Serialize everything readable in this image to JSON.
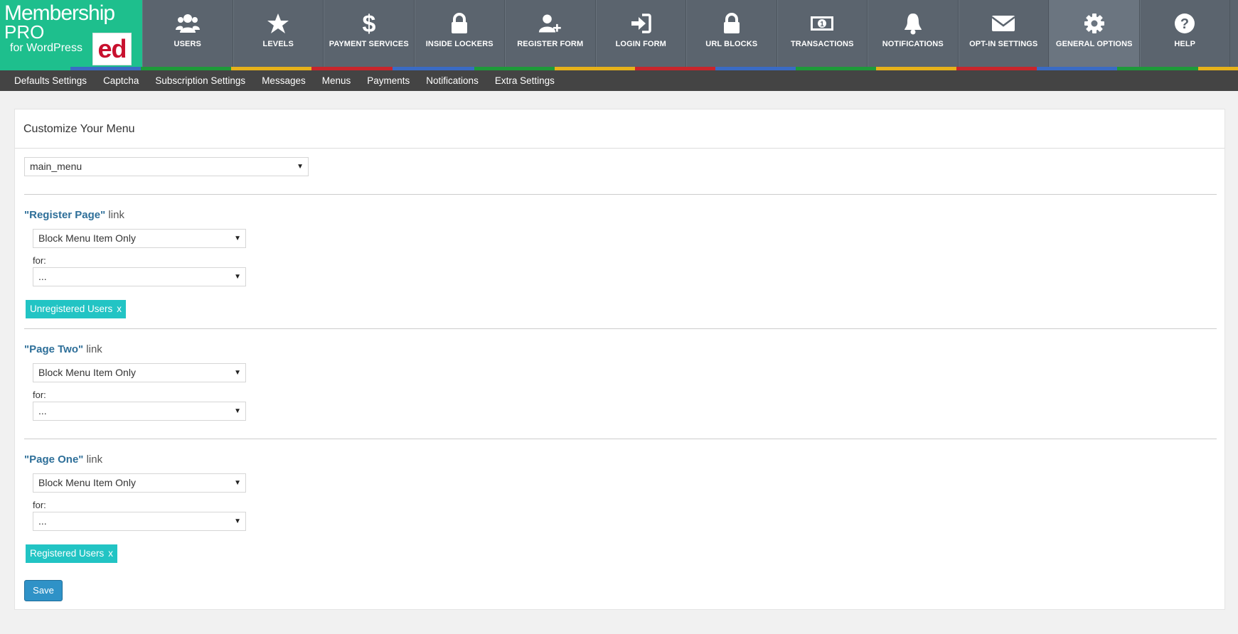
{
  "brand": {
    "line1": "Membership",
    "line2": "PRO",
    "line3": "for WordPress",
    "badge": "ed"
  },
  "tabs": [
    {
      "label": "USERS",
      "icon": "users-icon"
    },
    {
      "label": "LEVELS",
      "icon": "star-icon"
    },
    {
      "label": "PAYMENT SERVICES",
      "icon": "dollar-icon"
    },
    {
      "label": "INSIDE LOCKERS",
      "icon": "lock-icon"
    },
    {
      "label": "REGISTER FORM",
      "icon": "user-plus-icon"
    },
    {
      "label": "LOGIN FORM",
      "icon": "sign-in-icon"
    },
    {
      "label": "URL BLOCKS",
      "icon": "lock-icon"
    },
    {
      "label": "TRANSACTIONS",
      "icon": "money-icon"
    },
    {
      "label": "NOTIFICATIONS",
      "icon": "bell-icon"
    },
    {
      "label": "OPT-IN SETTINGS",
      "icon": "envelope-icon"
    },
    {
      "label": "GENERAL OPTIONS",
      "icon": "gear-icon",
      "active": true
    },
    {
      "label": "HELP",
      "icon": "question-icon"
    }
  ],
  "subnav": [
    "Defaults Settings",
    "Captcha",
    "Subscription Settings",
    "Messages",
    "Menus",
    "Payments",
    "Notifications",
    "Extra Settings"
  ],
  "panel": {
    "title": "Customize Your Menu",
    "menu_select": "main_menu",
    "items": [
      {
        "name": "\"Register Page\"",
        "suffix": " link",
        "mode": "Block Menu Item Only",
        "for_label": "for:",
        "for_value": "...",
        "chip": "Unregistered Users"
      },
      {
        "name": "\"Page Two\"",
        "suffix": " link",
        "mode": "Block Menu Item Only",
        "for_label": "for:",
        "for_value": "...",
        "chip": ""
      },
      {
        "name": "\"Page One\"",
        "suffix": " link",
        "mode": "Block Menu Item Only",
        "for_label": "for:",
        "for_value": "...",
        "chip": "Registered Users"
      }
    ],
    "chip_remove": "x",
    "save_label": "Save"
  },
  "colors": {
    "accent_green": "#1ebf8d",
    "chip": "#22c4c4",
    "save": "#2f92c7",
    "link": "#2e6f99"
  }
}
